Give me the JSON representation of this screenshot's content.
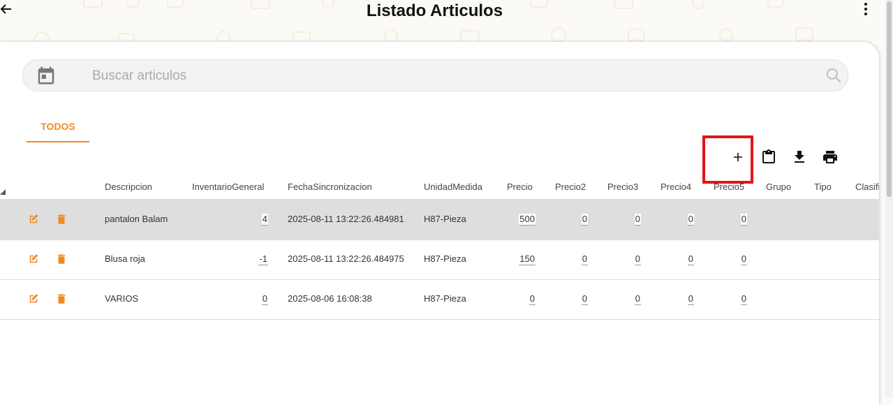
{
  "header": {
    "title": "Listado Articulos"
  },
  "search": {
    "placeholder": "Buscar articulos",
    "value": ""
  },
  "tabs": [
    {
      "label": "TODOS",
      "active": true
    }
  ],
  "toolbar": [
    "add-icon",
    "clipboard-icon",
    "download-icon",
    "print-icon"
  ],
  "colors": {
    "accent": "#f08a24",
    "highlight": "#e3141b",
    "selected_row": "#dedede"
  },
  "table": {
    "columns": [
      "Descripcion",
      "InventarioGeneral",
      "FechaSincronizacion",
      "UnidadMedida",
      "Precio",
      "Precio2",
      "Precio3",
      "Precio4",
      "Precio5",
      "Grupo",
      "Tipo",
      "Clasifi"
    ],
    "rows": [
      {
        "descripcion": "pantalon Balam",
        "inventario": "4",
        "fecha": "2025-08-11 13:22:26.484981",
        "unidad": "H87-Pieza",
        "precio": "500",
        "precio2": "0",
        "precio3": "0",
        "precio4": "0",
        "precio5": "0"
      },
      {
        "descripcion": "Blusa roja",
        "inventario": "-1",
        "fecha": "2025-08-11 13:22:26.484975",
        "unidad": "H87-Pieza",
        "precio": "150",
        "precio2": "0",
        "precio3": "0",
        "precio4": "0",
        "precio5": "0"
      },
      {
        "descripcion": "VARIOS",
        "inventario": "0",
        "fecha": "2025-08-06 16:08:38",
        "unidad": "H87-Pieza",
        "precio": "0",
        "precio2": "0",
        "precio3": "0",
        "precio4": "0",
        "precio5": "0"
      }
    ]
  }
}
